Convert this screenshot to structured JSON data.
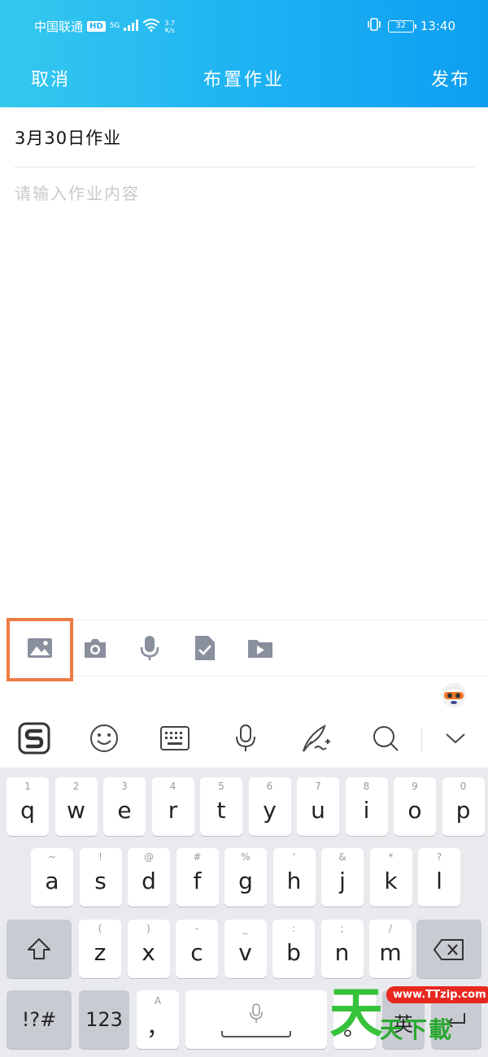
{
  "status_bar": {
    "carrier": "中国联通",
    "hd": "HD",
    "network": "5G",
    "speed_top": "3.7",
    "speed_bottom": "K/s",
    "battery": "32",
    "time": "13:40"
  },
  "nav": {
    "cancel": "取消",
    "title": "布置作业",
    "publish": "发布"
  },
  "form": {
    "title_value": "3月30日作业",
    "content_placeholder": "请输入作业内容"
  },
  "attachments": [
    {
      "name": "image",
      "icon": "image-icon"
    },
    {
      "name": "camera",
      "icon": "camera-icon"
    },
    {
      "name": "voice",
      "icon": "microphone-icon"
    },
    {
      "name": "document",
      "icon": "document-check-icon"
    },
    {
      "name": "video",
      "icon": "video-icon"
    }
  ],
  "colors": {
    "header_start": "#35c8ee",
    "header_end": "#0e9ef1",
    "highlight": "#ef7b45",
    "key_bg": "#ffffff",
    "keyboard_bg": "#e8eaee"
  },
  "keyboard": {
    "row1": [
      {
        "sub": "1",
        "main": "q"
      },
      {
        "sub": "2",
        "main": "w"
      },
      {
        "sub": "3",
        "main": "e"
      },
      {
        "sub": "4",
        "main": "r"
      },
      {
        "sub": "5",
        "main": "t"
      },
      {
        "sub": "6",
        "main": "y"
      },
      {
        "sub": "7",
        "main": "u"
      },
      {
        "sub": "8",
        "main": "i"
      },
      {
        "sub": "9",
        "main": "o"
      },
      {
        "sub": "0",
        "main": "p"
      }
    ],
    "row2": [
      {
        "sub": "~",
        "main": "a"
      },
      {
        "sub": "!",
        "main": "s"
      },
      {
        "sub": "@",
        "main": "d"
      },
      {
        "sub": "#",
        "main": "f"
      },
      {
        "sub": "%",
        "main": "g"
      },
      {
        "sub": "'",
        "main": "h"
      },
      {
        "sub": "&",
        "main": "j"
      },
      {
        "sub": "*",
        "main": "k"
      },
      {
        "sub": "?",
        "main": "l"
      }
    ],
    "row3": [
      {
        "sub": "(",
        "main": "z"
      },
      {
        "sub": ")",
        "main": "x"
      },
      {
        "sub": "-",
        "main": "c"
      },
      {
        "sub": "_",
        "main": "v"
      },
      {
        "sub": ":",
        "main": "b"
      },
      {
        "sub": ";",
        "main": "n"
      },
      {
        "sub": "/",
        "main": "m"
      }
    ],
    "symbols": "!?#",
    "numbers": "123",
    "comma_sub": "A",
    "comma": "，",
    "period": "。",
    "lang": "英"
  },
  "watermark": {
    "big": "天",
    "url": "www.TTzip.com",
    "text": "天下載"
  }
}
